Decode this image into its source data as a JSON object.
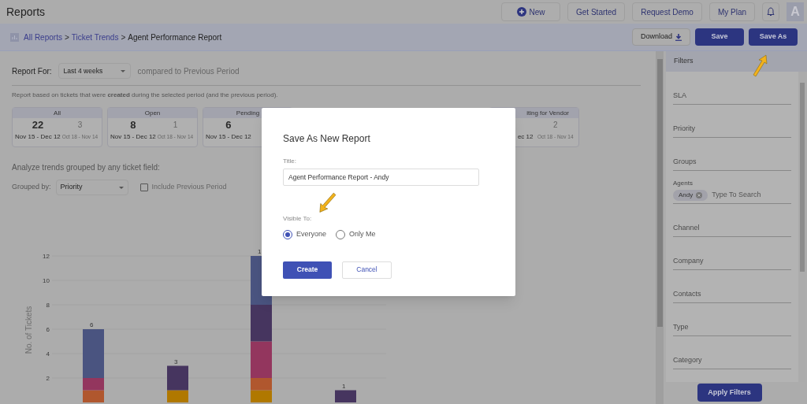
{
  "header": {
    "title": "Reports",
    "buttons": [
      {
        "label": "New",
        "kind": "new"
      },
      {
        "label": "Get Started",
        "kind": "plain"
      },
      {
        "label": "Request Demo",
        "kind": "plain"
      },
      {
        "label": "My Plan",
        "kind": "plain"
      }
    ],
    "avatar": "A"
  },
  "breadcrumb": {
    "separator": ">",
    "items": [
      {
        "label": "All Reports",
        "kind": "link"
      },
      {
        "label": "Ticket Trends",
        "kind": "link"
      },
      {
        "label": "Agent Performance Report",
        "kind": "current"
      }
    ]
  },
  "actions": [
    {
      "label": "Download",
      "kind": "download"
    },
    {
      "label": "Save",
      "kind": "primary"
    },
    {
      "label": "Save As",
      "kind": "primary"
    }
  ],
  "report_for": {
    "label": "Report For:",
    "value": "Last 4 weeks",
    "suffix": "compared to Previous Period"
  },
  "description": "Report based on tickets that were **created** during the selected period (and the previous period).",
  "cards": [
    {
      "kind": "full",
      "label": "All",
      "count": "22",
      "previous": "3",
      "range": "Nov 15 - Dec 12",
      "previous_range": "Oct 18 - Nov 14"
    },
    {
      "kind": "full",
      "label": "Open",
      "count": "8",
      "previous": "1",
      "range": "Nov 15 - Dec 12",
      "previous_range": "Oct 18 - Nov 14"
    },
    {
      "kind": "full",
      "label": "Pending",
      "count": "6",
      "range": "Nov 15 - Dec 12"
    },
    {
      "kind": "cut",
      "label": "iting for Vendor",
      "previous": "2",
      "range": "ec 12",
      "previous_range": "Oct 18 - Nov 14"
    }
  ],
  "analyze": {
    "heading": "Analyze trends grouped by any ticket field:",
    "grouped_label": "Grouped by:",
    "grouped_value": "Priority",
    "include_previous": {
      "label": "Include Previous Period",
      "checked": false
    }
  },
  "chart": {
    "total_labels": [
      "6",
      "3",
      "1",
      "1"
    ],
    "chart_data": {
      "type": "bar",
      "ylabel": "No. of Tickets",
      "ylim": [
        0,
        12
      ],
      "yticks": [
        2,
        4,
        6,
        8,
        10,
        12
      ],
      "stacked": true,
      "series": [
        {
          "color": "#b07800",
          "values": [
            0,
            1,
            1,
            0
          ]
        },
        {
          "color": "#b0572e",
          "values": [
            1,
            0,
            1,
            0
          ]
        },
        {
          "color": "#93365e",
          "values": [
            1,
            0,
            3,
            0
          ]
        },
        {
          "color": "#46355f",
          "values": [
            0,
            2,
            3,
            1
          ]
        },
        {
          "color": "#4a5480",
          "values": [
            4,
            0,
            4,
            0
          ]
        }
      ]
    }
  },
  "filters": {
    "title": "Filters",
    "fields": [
      {
        "label": "SLA",
        "kind": "plain"
      },
      {
        "label": "Priority",
        "kind": "plain"
      },
      {
        "label": "Groups",
        "kind": "plain"
      },
      {
        "label": "Agents",
        "kind": "chips",
        "chips": [
          "Andy"
        ],
        "placeholder": "Type To Search"
      },
      {
        "label": "Channel",
        "kind": "plain"
      },
      {
        "label": "Company",
        "kind": "plain"
      },
      {
        "label": "Contacts",
        "kind": "plain"
      },
      {
        "label": "Type",
        "kind": "plain"
      },
      {
        "label": "Category",
        "kind": "plain"
      }
    ],
    "apply": "Apply Filters"
  },
  "dialog": {
    "title": "Save As New Report",
    "title_label": "Title:",
    "title_value": "Agent Performance Report - Andy",
    "visible_label": "Visible To:",
    "options": [
      {
        "label": "Everyone",
        "selected": true
      },
      {
        "label": "Only Me",
        "selected": false
      }
    ],
    "create": "Create",
    "cancel": "Cancel"
  }
}
